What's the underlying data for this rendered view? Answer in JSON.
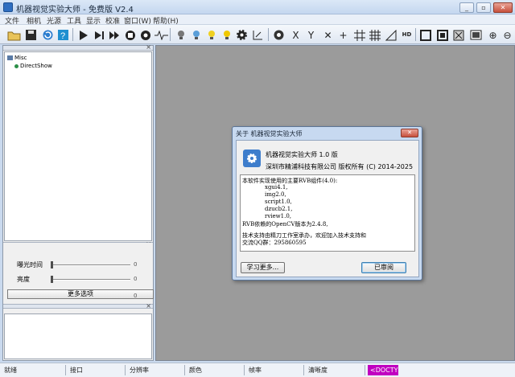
{
  "window": {
    "title": "机器视觉实验大师 - 免费版 V2.4"
  },
  "menu": [
    "文件",
    "相机",
    "光源",
    "工具",
    "显示",
    "校准",
    "窗口(W)",
    "帮助(H)"
  ],
  "tree": {
    "root": "Misc",
    "child": "DirectShow"
  },
  "controls": {
    "exposure": {
      "label": "曝光时间",
      "value": "0"
    },
    "brightness": {
      "label": "亮度",
      "value": "0"
    },
    "more_button": "更多选项",
    "more_value": "0"
  },
  "about": {
    "title": "关于 机器视觉实验大师",
    "close": "✕",
    "product": "机器视觉实验大师 1.0 版",
    "copyright": "深圳市精浦科技有限公司 版权所有 (C) 2014-2025",
    "info_lines": [
      "本软件实现使用的主要RVB组件(4.0):",
      "xgui4.1,",
      "img2.0,",
      "script1.0,",
      "dzucb2.1,",
      "rview1.0,",
      "RVB依赖的OpenCV版本为2.4.8,",
      "技术支持由精刀工作室承办，欢迎加入技术支持和",
      "交流QQ群：295860595"
    ],
    "learn_more": "学习更多...",
    "ok": "已审阅"
  },
  "status": [
    "就绪",
    "接口",
    "分辨率",
    "颜色",
    "帧率",
    "清晰度",
    "<DOCTY"
  ],
  "icons": {
    "app": "app-icon",
    "toolbar": [
      "open-folder-icon",
      "save-icon",
      "refresh-icon",
      "help-icon",
      "play-icon",
      "step-play-icon",
      "skip-play-icon",
      "stop-icon",
      "record-icon",
      "waveform-icon",
      "bulb-icon",
      "bulb-color-icon",
      "light-bulb-icon",
      "gear-icon",
      "measure-icon",
      "target-icon",
      "x-axis-icon",
      "y-axis-icon",
      "cross-dots-icon",
      "crosshair-icon",
      "grid-icon",
      "grid-dense-icon",
      "triangle-icon",
      "hd-icon",
      "square-icon",
      "square-border-icon",
      "fullscreen-icon",
      "image-icon",
      "zoom-in-icon",
      "zoom-out-icon"
    ]
  },
  "colors": {
    "canvas": "#9b9b9b",
    "status_accent": "#c000c0",
    "titlebar": "#c4d7ef"
  }
}
